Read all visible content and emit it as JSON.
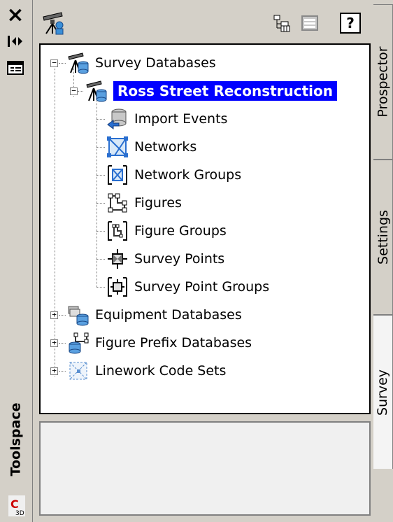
{
  "window": {
    "title": "Toolspace"
  },
  "tree": {
    "root": {
      "label": "Survey Databases",
      "icon": "survey-databases-icon",
      "expanded": true,
      "children": [
        {
          "label": "Ross Street Reconstruction",
          "icon": "survey-database-icon",
          "selected": true,
          "children": [
            {
              "label": "Import Events",
              "icon": "import-events-icon"
            },
            {
              "label": "Networks",
              "icon": "networks-icon"
            },
            {
              "label": "Network Groups",
              "icon": "network-groups-icon"
            },
            {
              "label": "Figures",
              "icon": "figures-icon"
            },
            {
              "label": "Figure Groups",
              "icon": "figure-groups-icon"
            },
            {
              "label": "Survey Points",
              "icon": "survey-points-icon"
            },
            {
              "label": "Survey Point Groups",
              "icon": "survey-point-groups-icon"
            }
          ]
        }
      ]
    },
    "siblings": [
      {
        "label": "Equipment Databases",
        "icon": "equipment-databases-icon"
      },
      {
        "label": "Figure Prefix Databases",
        "icon": "figure-prefix-databases-icon"
      },
      {
        "label": "Linework Code Sets",
        "icon": "linework-code-sets-icon"
      }
    ]
  },
  "tabs": [
    {
      "label": "Prospector",
      "active": false
    },
    {
      "label": "Settings",
      "active": false
    },
    {
      "label": "Survey",
      "active": true
    }
  ],
  "toolbar": {
    "help_label": "?"
  },
  "colors": {
    "selection": "#0000ff",
    "chrome": "#d4d0c8"
  }
}
